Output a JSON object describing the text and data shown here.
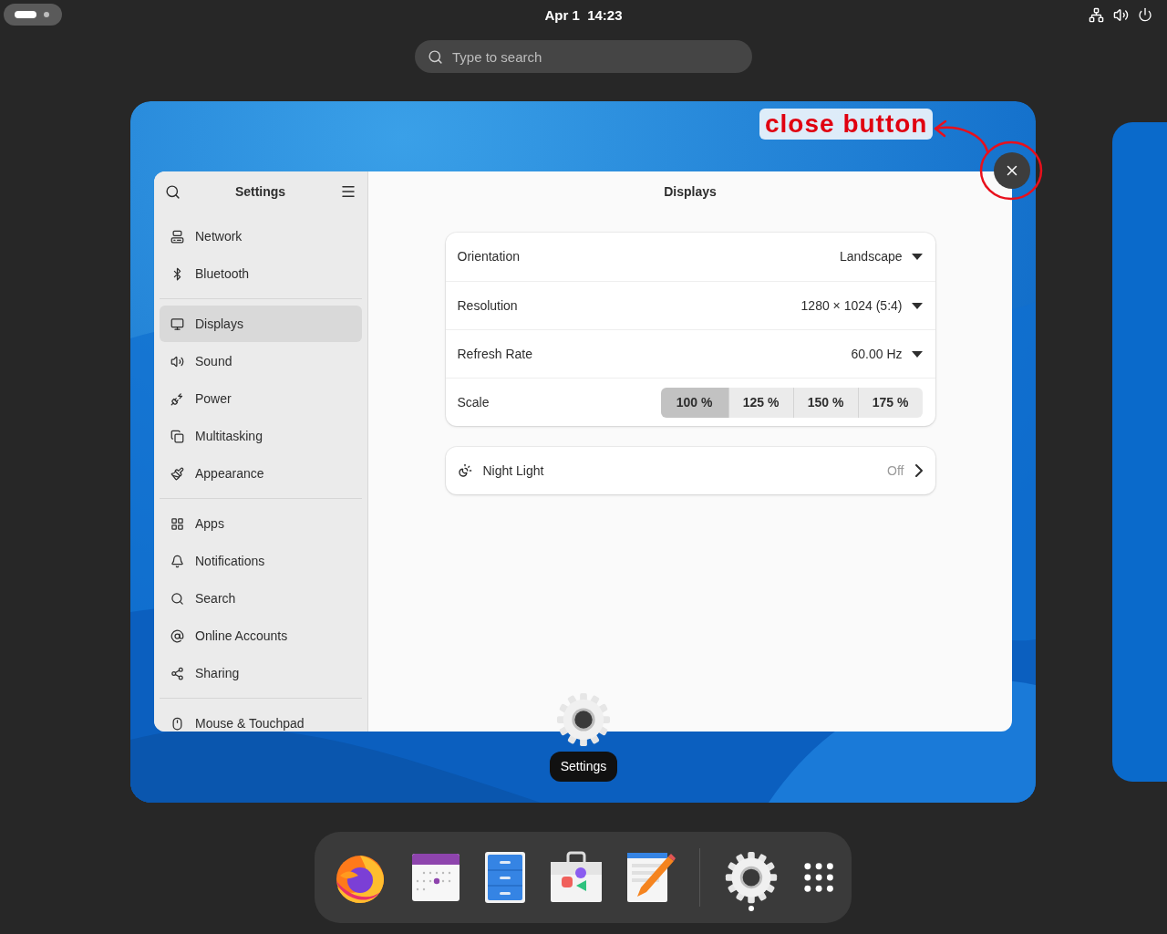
{
  "top_bar": {
    "clock": "Apr 1  14:23"
  },
  "search": {
    "placeholder": "Type to search"
  },
  "window": {
    "sidebar": {
      "title": "Settings",
      "groups": [
        [
          {
            "label": "Network",
            "selected": false
          },
          {
            "label": "Bluetooth",
            "selected": false
          }
        ],
        [
          {
            "label": "Displays",
            "selected": true
          },
          {
            "label": "Sound",
            "selected": false
          },
          {
            "label": "Power",
            "selected": false
          },
          {
            "label": "Multitasking",
            "selected": false
          },
          {
            "label": "Appearance",
            "selected": false
          }
        ],
        [
          {
            "label": "Apps",
            "selected": false
          },
          {
            "label": "Notifications",
            "selected": false
          },
          {
            "label": "Search",
            "selected": false
          },
          {
            "label": "Online Accounts",
            "selected": false
          },
          {
            "label": "Sharing",
            "selected": false
          }
        ],
        [
          {
            "label": "Mouse & Touchpad",
            "selected": false
          }
        ]
      ]
    },
    "title": "Displays",
    "rows": [
      {
        "kind": "dropdown",
        "label": "Orientation",
        "value": "Landscape"
      },
      {
        "kind": "dropdown",
        "label": "Resolution",
        "value": "1280 × 1024 (5:4)"
      },
      {
        "kind": "dropdown",
        "label": "Refresh Rate",
        "value": "60.00 Hz"
      },
      {
        "kind": "segmented",
        "label": "Scale",
        "options": [
          {
            "label": "100 %",
            "selected": true
          },
          {
            "label": "125 %",
            "selected": false
          },
          {
            "label": "150 %",
            "selected": false
          },
          {
            "label": "175 %",
            "selected": false
          }
        ]
      }
    ],
    "night_light": {
      "label": "Night Light",
      "value": "Off"
    }
  },
  "window_label": "Settings",
  "annotation": {
    "text": "close button"
  },
  "dock": {
    "apps": [
      {
        "running": false
      },
      {
        "running": false
      },
      {
        "running": false
      },
      {
        "running": false
      },
      {
        "running": false
      },
      {
        "running": true
      }
    ]
  }
}
